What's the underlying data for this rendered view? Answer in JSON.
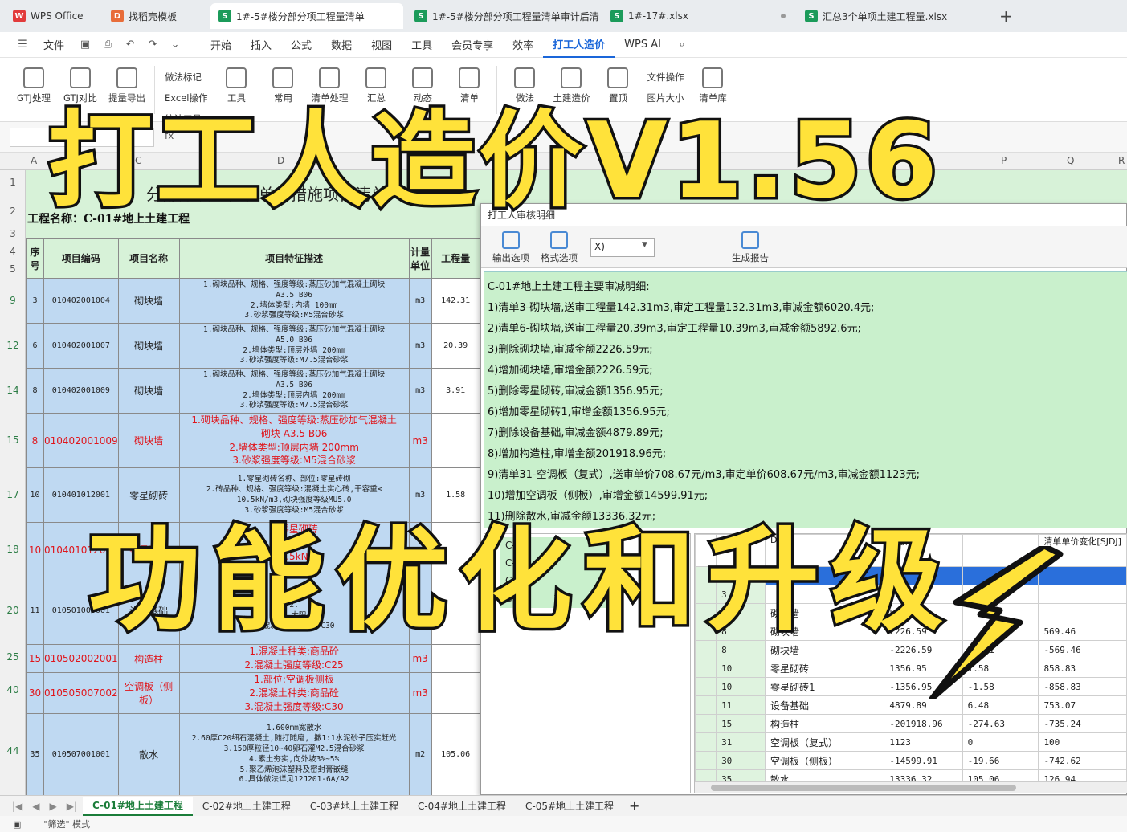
{
  "tabs": [
    {
      "icon": "W",
      "label": "WPS Office",
      "kind": "wps"
    },
    {
      "icon": "D",
      "label": "找稻壳模板",
      "kind": "doc"
    },
    {
      "icon": "S",
      "label": "1#-5#楼分部分项工程量清单",
      "kind": "s",
      "active": true
    },
    {
      "icon": "S",
      "label": "1#-5#楼分部分项工程量清单审计后清",
      "kind": "s"
    },
    {
      "icon": "S",
      "label": "1#-17#.xlsx",
      "kind": "s"
    },
    {
      "icon": "S",
      "label": "汇总3个单项土建工程量.xlsx",
      "kind": "s"
    }
  ],
  "menu": {
    "file": "文件",
    "items": [
      "开始",
      "插入",
      "公式",
      "数据",
      "视图",
      "工具",
      "会员专享",
      "效率",
      "打工人造价",
      "WPS AI"
    ],
    "active": "打工人造价"
  },
  "ribbon": {
    "buttons": [
      "GTJ处理",
      "GTJ对比",
      "提量导出",
      "工具",
      "常用",
      "清单处理",
      "汇总",
      "动态",
      "清单",
      "做法",
      "土建造价",
      "置顶",
      "清单库"
    ],
    "small": [
      "做法标记",
      "Excel操作",
      "统计工具",
      "文件操作",
      "图片大小"
    ]
  },
  "formula": {
    "fx": "fx"
  },
  "columns": [
    "A",
    "B",
    "C",
    "D",
    "P",
    "Q",
    "R"
  ],
  "sheet": {
    "title": "分部分项工程和单价措施项目清单",
    "project": "工程名称：C-01#地上土建工程",
    "headers": {
      "seq": "序号",
      "code": "项目编码",
      "name": "项目名称",
      "desc": "项目特征描述",
      "unit": "计量单位",
      "qty": "工程量"
    },
    "header_rows": [
      "1",
      "2",
      "3",
      "4",
      "5"
    ],
    "rows": [
      {
        "row": "9",
        "seq": "3",
        "code": "010402001004",
        "name": "砌块墙",
        "desc": "1.砌块品种、规格、强度等级:蒸压砂加气混凝土砌块\nA3.5 B06\n2.墙体类型:内墙 100mm\n3.砂浆强度等级:M5混合砂浆",
        "unit": "m3",
        "qty": "142.31",
        "red": false
      },
      {
        "row": "12",
        "seq": "6",
        "code": "010402001007",
        "name": "砌块墙",
        "desc": "1.砌块品种、规格、强度等级:蒸压砂加气混凝土砌块\nA5.0 B06\n2.墙体类型:顶层外墙 200mm\n3.砂浆强度等级:M7.5混合砂浆",
        "unit": "m3",
        "qty": "20.39",
        "red": false
      },
      {
        "row": "14",
        "seq": "8",
        "code": "010402001009",
        "name": "砌块墙",
        "desc": "1.砌块品种、规格、强度等级:蒸压砂加气混凝土砌块\nA3.5 B06\n2.墙体类型:顶层内墙 200mm\n3.砂浆强度等级:M7.5混合砂浆",
        "unit": "m3",
        "qty": "3.91",
        "red": false
      },
      {
        "row": "15",
        "seq": "8",
        "code": "010402001009",
        "name": "砌块墙",
        "desc": "1.砌块品种、规格、强度等级:蒸压砂加气混凝土\n砌块 A3.5 B06\n2.墙体类型:顶层内墙 200mm\n3.砂浆强度等级:M5混合砂浆",
        "unit": "m3",
        "qty": "",
        "red": true
      },
      {
        "row": "17",
        "seq": "10",
        "code": "010401012001",
        "name": "零星砌砖",
        "desc": "1.零星砌砖名称、部位:零星砖砌\n2.砖品种、规格、强度等级:混凝土实心砖,干容重≤\n10.5kN/m3,砌块强度等级MU5.0\n3.砂浆强度等级:M5混合砂浆",
        "unit": "m3",
        "qty": "1.58",
        "red": false
      },
      {
        "row": "18",
        "seq": "10",
        "code": "010401012001",
        "name": "零星砌砖",
        "desc": "1.零星砌砖\n2.规格\n3.5kN\n4.强",
        "unit": "",
        "qty": "",
        "red": true
      },
      {
        "row": "20",
        "seq": "11",
        "code": "010501006001",
        "name": "设备基础",
        "desc": "1.\n2.\n3.太阳\n4.混凝土强度等级:C30",
        "unit": "",
        "qty": "",
        "red": false
      },
      {
        "row": "25",
        "seq": "15",
        "code": "010502002001",
        "name": "构造柱",
        "desc": "1.混凝土种类:商品砼\n2.混凝土强度等级:C25",
        "unit": "m3",
        "qty": "",
        "red": true
      },
      {
        "row": "40",
        "seq": "30",
        "code": "010505007002",
        "name": "空调板（侧板）",
        "desc": "1.部位:空调板侧板\n2.混凝土种类:商品砼\n3.混凝土强度等级:C30",
        "unit": "m3",
        "qty": "",
        "red": true
      },
      {
        "row": "44",
        "seq": "35",
        "code": "010507001001",
        "name": "散水",
        "desc": "1.600mm宽散水\n2.60厚C20细石混凝土,随打随磨, 撒1:1水泥砂子压实赶光\n3.150厚粒径10~40卵石灌M2.5混合砂浆\n4.素土夯实,向外坡3%~5%\n5.聚乙烯泡沫塑料及密封膏嵌缝\n6.具体做法详见12J201-6A/A2",
        "unit": "m2",
        "qty": "105.06",
        "red": false
      }
    ]
  },
  "dialog": {
    "title": "打工人审核明细",
    "buttons": [
      "输出选项",
      "格式选项",
      "生成报告"
    ],
    "combo": "X)",
    "summary_title": "C-01#地上土建工程主要审减明细:",
    "summary": [
      "1)清单3-砌块墙,送审工程量142.31m3,审定工程量132.31m3,审减金额6020.4元;",
      "2)清单6-砌块墙,送审工程量20.39m3,审定工程量10.39m3,审减金额5892.6元;",
      "3)删除砌块墙,审减金额2226.59元;",
      "4)增加砌块墙,审增金额2226.59元;",
      "5)删除零星砌砖,审减金额1356.95元;",
      "6)增加零星砌砖1,审增金额1356.95元;",
      "7)删除设备基础,审减金额4879.89元;",
      "8)增加构造柱,审增金额201918.96元;",
      "9)清单31-空调板（复式）,送审单价708.67元/m3,审定单价608.67元/m3,审减金额1123元;",
      "10)增加空调板（侧板）,审增金额14599.91元;",
      "11)删除散水,审减金额13336.32元;"
    ],
    "left_list": [
      "C-",
      "C-",
      "C-",
      "C-"
    ],
    "right_header": [
      "",
      "",
      "Dif",
      "金额",
      "",
      "清单单价变化[SJDJ]"
    ],
    "right_rows": [
      {
        "n": "",
        "name": "",
        "amt": "",
        "qty": "",
        "price": "",
        "sel": true
      },
      {
        "n": "3",
        "name": "",
        "amt": "6020.4",
        "qty": "",
        "price": ""
      },
      {
        "n": "6",
        "name": "砌块墙",
        "amt": "5892.6",
        "qty": "",
        "price": ""
      },
      {
        "n": "8",
        "name": "砌块墙",
        "amt": "2226.59",
        "qty": "",
        "price": "569.46"
      },
      {
        "n": "8",
        "name": "砌块墙",
        "amt": "-2226.59",
        "qty": "-3.91",
        "price": "-569.46"
      },
      {
        "n": "10",
        "name": "零星砌砖",
        "amt": "1356.95",
        "qty": "1.58",
        "price": "858.83"
      },
      {
        "n": "10",
        "name": "零星砌砖1",
        "amt": "-1356.95",
        "qty": "-1.58",
        "price": "-858.83"
      },
      {
        "n": "11",
        "name": "设备基础",
        "amt": "4879.89",
        "qty": "6.48",
        "price": "753.07"
      },
      {
        "n": "15",
        "name": "构造柱",
        "amt": "-201918.96",
        "qty": "-274.63",
        "price": "-735.24"
      },
      {
        "n": "31",
        "name": "空调板（复式）",
        "amt": "1123",
        "qty": "0",
        "price": "100"
      },
      {
        "n": "30",
        "name": "空调板（侧板）",
        "amt": "-14599.91",
        "qty": "-19.66",
        "price": "-742.62"
      },
      {
        "n": "35",
        "name": "散水",
        "amt": "13336.32",
        "qty": "105.06",
        "price": "126.94"
      }
    ]
  },
  "sheet_tabs": [
    "C-01#地上土建工程",
    "C-02#地上土建工程",
    "C-03#地上土建工程",
    "C-04#地上土建工程",
    "C-05#地上土建工程"
  ],
  "status": {
    "mode": "\"筛选\" 模式"
  },
  "overlay": {
    "top": "打工人造价V1.56",
    "bottom": "功能优化和升级"
  },
  "colors": {
    "accent": "#1a66d9",
    "sheet_bg": "#d7f2d8",
    "cell_blue": "#bfd9f2",
    "red_text": "#e0141a",
    "banner": "#ffe23a"
  }
}
